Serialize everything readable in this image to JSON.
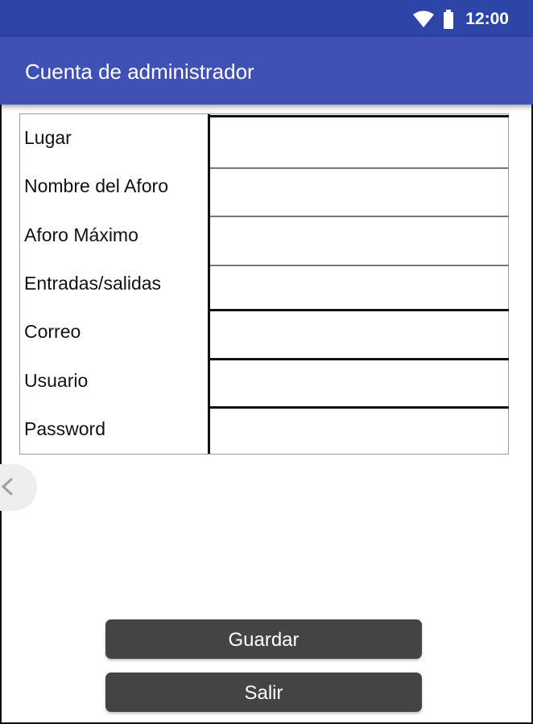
{
  "status_bar": {
    "time": "12:00",
    "icons": [
      "wifi-icon",
      "battery-icon"
    ],
    "background": "#2d45a6"
  },
  "app_bar": {
    "title": "Cuenta de administrador",
    "background": "#3f51b5"
  },
  "form": {
    "fields": [
      {
        "label": "Lugar",
        "value": ""
      },
      {
        "label": "Nombre del Aforo",
        "value": ""
      },
      {
        "label": "Aforo Máximo",
        "value": ""
      },
      {
        "label": "Entradas/salidas",
        "value": ""
      },
      {
        "label": "Correo",
        "value": ""
      },
      {
        "label": "Usuario",
        "value": ""
      },
      {
        "label": "Password",
        "value": ""
      }
    ]
  },
  "actions": {
    "save_label": "Guardar",
    "exit_label": "Salir",
    "button_color": "#444444"
  }
}
